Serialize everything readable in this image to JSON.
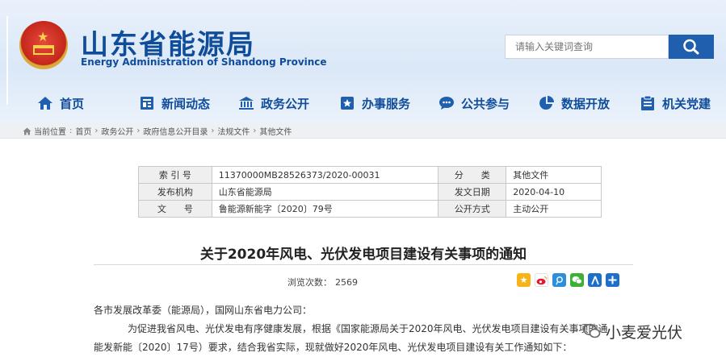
{
  "header": {
    "site_title": "山东省能源局",
    "site_subtitle": "Energy Administration of Shandong Province"
  },
  "search": {
    "placeholder": "请输入关键词查询"
  },
  "nav": [
    {
      "label": "首页",
      "icon": "home-icon"
    },
    {
      "label": "新闻动态",
      "icon": "news-icon"
    },
    {
      "label": "政务公开",
      "icon": "government-building-icon"
    },
    {
      "label": "办事服务",
      "icon": "service-star-icon"
    },
    {
      "label": "公共参与",
      "icon": "chat-bubble-icon"
    },
    {
      "label": "数据开放",
      "icon": "pie-chart-icon"
    },
    {
      "label": "机关党建",
      "icon": "clipboard-icon"
    }
  ],
  "breadcrumb": {
    "prefix": "当前位置",
    "items": [
      "首页",
      "政务公开",
      "政府信息公开目录",
      "法规文件",
      "其他文件"
    ]
  },
  "info_table": {
    "index_label": "索 引 号",
    "index_value": "11370000MB28526373/2020-00031",
    "category_label": "分　　类",
    "category_value": "其他文件",
    "publisher_label": "发布机构",
    "publisher_value": "山东省能源局",
    "date_label": "发文日期",
    "date_value": "2020-04-10",
    "docno_label": "文　　号",
    "docno_value": "鲁能源新能字〔2020〕79号",
    "openness_label": "公开方式",
    "openness_value": "主动公开"
  },
  "article": {
    "title": "关于2020年风电、光伏发电项目建设有关事项的通知",
    "views_label": "浏览次数：",
    "views_value": "2569",
    "recipients": "各市发展改革委（能源局），国网山东省电力公司：",
    "para1_line1": "为促进我省风电、光伏发电有序健康发展，根据《国家能源局关于2020年风电、光伏发电项目建设有关事项的通",
    "para1_line2": "能发新能〔2020〕17号）要求，结合我省实际，现就做好2020年风电、光伏发电项目建设有关工作通知如下："
  },
  "share_buttons": [
    "qzone-icon",
    "weibo-icon",
    "tencent-weibo-icon",
    "wechat-icon",
    "renren-icon",
    "more-share-icon"
  ],
  "watermark": {
    "text": "小麦爱光伏"
  },
  "colors": {
    "brand_blue": "#0f4c9a",
    "search_button": "#1f5fae",
    "header_bg": "#dbe8f7"
  }
}
